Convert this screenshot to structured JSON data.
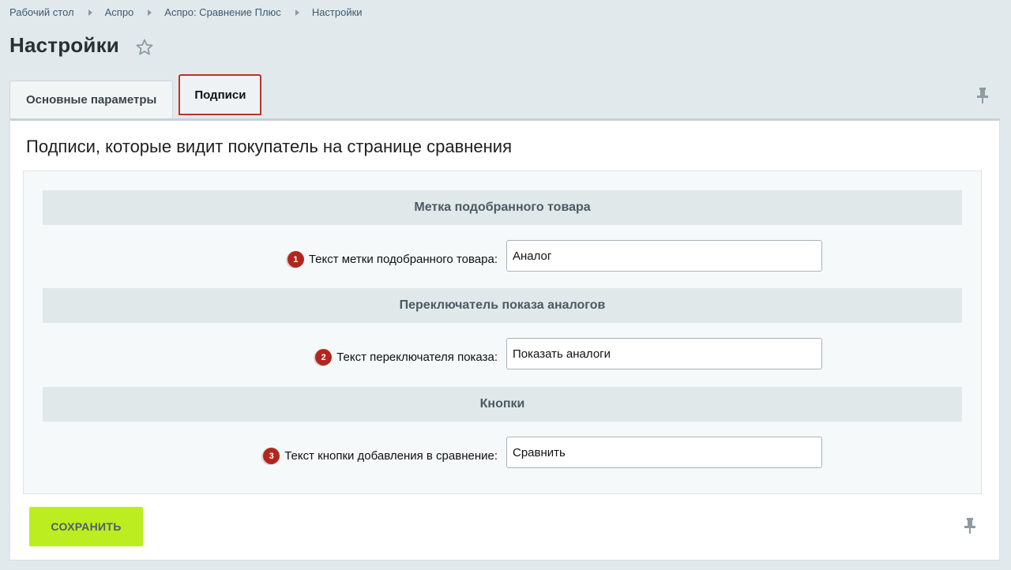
{
  "breadcrumb": {
    "items": [
      "Рабочий стол",
      "Аспро",
      "Аспро: Сравнение Плюс",
      "Настройки"
    ]
  },
  "page": {
    "title": "Настройки"
  },
  "tabs": [
    {
      "label": "Основные параметры",
      "active": false
    },
    {
      "label": "Подписи",
      "active": true
    }
  ],
  "section": {
    "title": "Подписи, которые видит покупатель на странице сравнения"
  },
  "groups": [
    {
      "header": "Метка подобранного товара",
      "field": {
        "badge": "1",
        "label": "Текст метки подобранного товара:",
        "value": "Аналог"
      }
    },
    {
      "header": "Переключатель показа аналогов",
      "field": {
        "badge": "2",
        "label": "Текст переключателя показа:",
        "value": "Показать аналоги"
      }
    },
    {
      "header": "Кнопки",
      "field": {
        "badge": "3",
        "label": "Текст кнопки добавления в сравнение:",
        "value": "Сравнить"
      }
    }
  ],
  "footer": {
    "save_label": "СОХРАНИТЬ"
  },
  "colors": {
    "accent_tab_border": "#b8342a",
    "badge": "#b3261e",
    "save_button": "#bbed21"
  },
  "icons": {
    "favorite": "star-icon",
    "pin": "pin-icon"
  }
}
